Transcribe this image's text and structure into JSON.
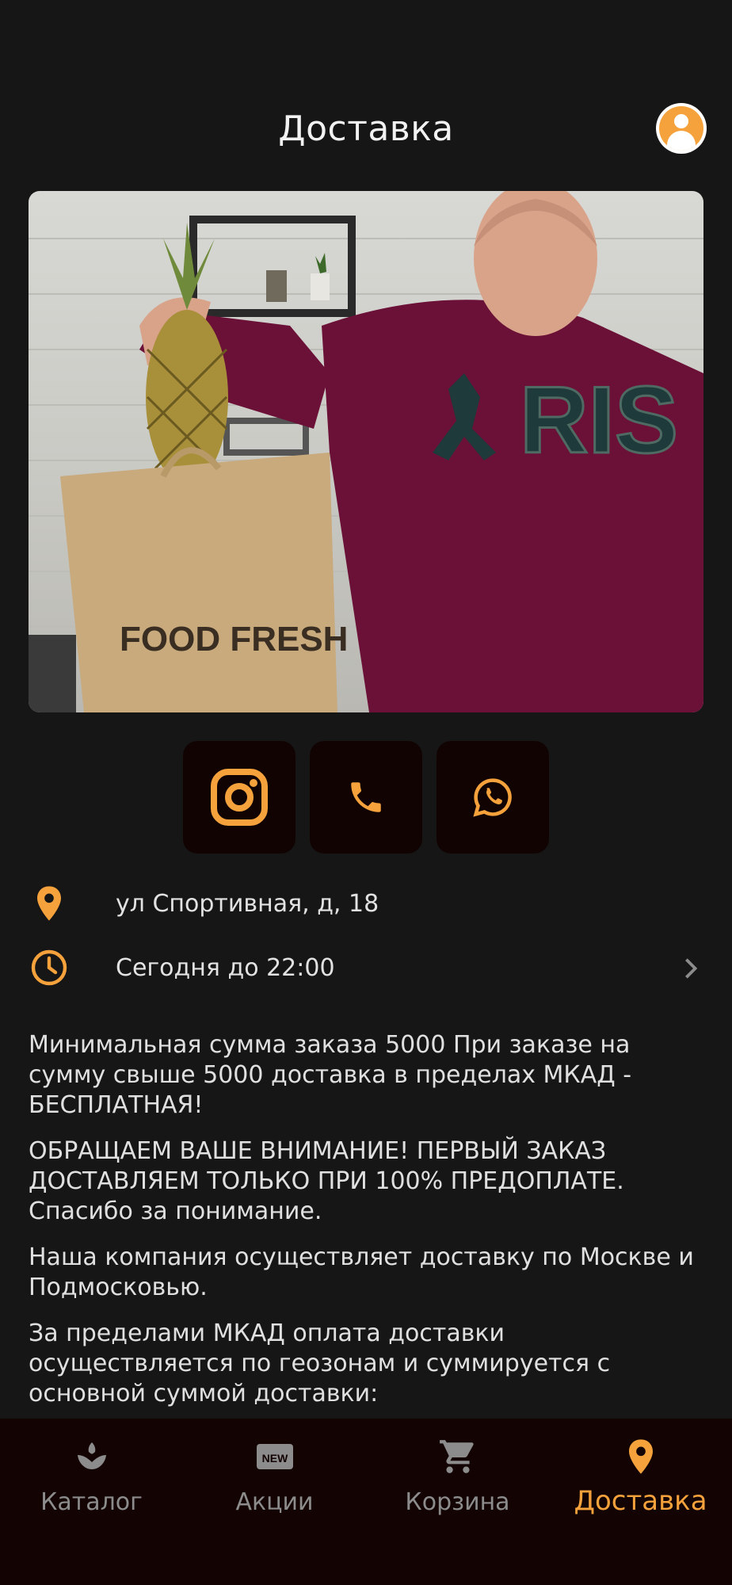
{
  "header": {
    "title": "Доставка"
  },
  "hero": {
    "bag_text": "FOOD FRESH"
  },
  "contacts": {
    "instagram_icon": "instagram-icon",
    "phone_icon": "phone-icon",
    "whatsapp_icon": "whatsapp-icon"
  },
  "info": {
    "address": "ул Спортивная, д, 18",
    "hours": "Сегодня до 22:00"
  },
  "description": [
    "Минимальная сумма заказа 5000 При заказе на сумму свыше 5000 доставка в пределах МКАД - БЕСПЛАТНАЯ!",
    "ОБРАЩАЕМ ВАШЕ ВНИМАНИЕ! ПЕРВЫЙ ЗАКАЗ ДОСТАВЛЯЕМ ТОЛЬКО ПРИ 100% ПРЕДОПЛАТЕ. Спасибо за понимание.",
    "Наша компания осуществляет доставку по Москве и Подмосковью.",
    "За пределами МКАД оплата доставки осуществляется по геозонам и суммируется с основной суммой доставки:"
  ],
  "tabs": [
    {
      "label": "Каталог",
      "icon": "catalog-icon",
      "active": false
    },
    {
      "label": "Акции",
      "icon": "new-badge-icon",
      "active": false
    },
    {
      "label": "Корзина",
      "icon": "cart-icon",
      "active": false
    },
    {
      "label": "Доставка",
      "icon": "location-pin-icon",
      "active": true
    }
  ],
  "colors": {
    "accent": "#f5a23c",
    "background": "#161616",
    "tabbar": "#130303",
    "inactive": "#8c8c8c"
  }
}
